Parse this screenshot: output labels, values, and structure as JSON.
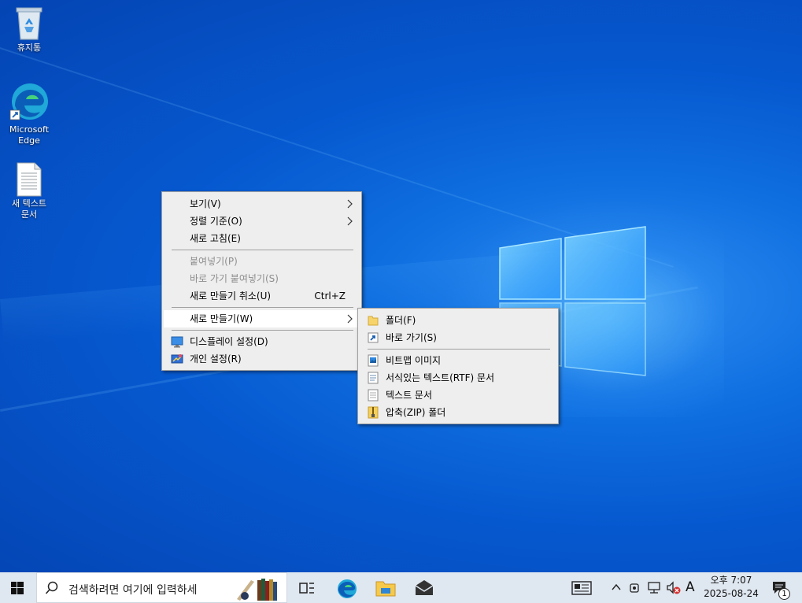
{
  "desktop": {
    "icons": [
      {
        "label": "휴지통",
        "icon": "recycle-bin-icon"
      },
      {
        "label_line1": "Microsoft",
        "label_line2": "Edge",
        "icon": "edge-icon"
      },
      {
        "label_line1": "새 텍스트",
        "label_line2": "문서",
        "icon": "text-document-icon"
      }
    ]
  },
  "context_menu": {
    "items": [
      {
        "label": "보기(V)",
        "has_submenu": true
      },
      {
        "label": "정렬 기준(O)",
        "has_submenu": true
      },
      {
        "label": "새로 고침(E)"
      },
      {
        "label": "붙여넣기(P)",
        "disabled": true
      },
      {
        "label": "바로 가기 붙여넣기(S)",
        "disabled": true
      },
      {
        "label": "새로 만들기 취소(U)",
        "shortcut": "Ctrl+Z"
      },
      {
        "label": "새로 만들기(W)",
        "has_submenu": true,
        "highlighted": true
      },
      {
        "label": "디스플레이 설정(D)",
        "icon": "display-icon"
      },
      {
        "label": "개인 설정(R)",
        "icon": "personalize-icon"
      }
    ]
  },
  "submenu_new": {
    "items": [
      {
        "label": "폴더(F)",
        "icon": "folder-icon"
      },
      {
        "label": "바로 가기(S)",
        "icon": "shortcut-icon"
      },
      {
        "label": "비트맵 이미지",
        "icon": "bitmap-icon"
      },
      {
        "label": "서식있는 텍스트(RTF) 문서",
        "icon": "rtf-document-icon"
      },
      {
        "label": "텍스트 문서",
        "icon": "text-document-icon"
      },
      {
        "label": "압축(ZIP) 폴더",
        "icon": "zip-folder-icon"
      }
    ]
  },
  "taskbar": {
    "search_placeholder": "검색하려면 여기에 입력하세",
    "apps": [
      "task-view-icon",
      "edge-icon",
      "file-explorer-icon",
      "mail-icon"
    ],
    "tray": {
      "ime": "A",
      "time": "오후 7:07",
      "date": "2025-08-24",
      "notification_count": "1"
    }
  },
  "colors": {
    "menu_bg": "#eeeeee",
    "menu_highlight": "#ffffff",
    "disabled_text": "#8e8e8e",
    "taskbar_bg": "#dfe7f0",
    "desktop_blue": "#0658cf"
  }
}
